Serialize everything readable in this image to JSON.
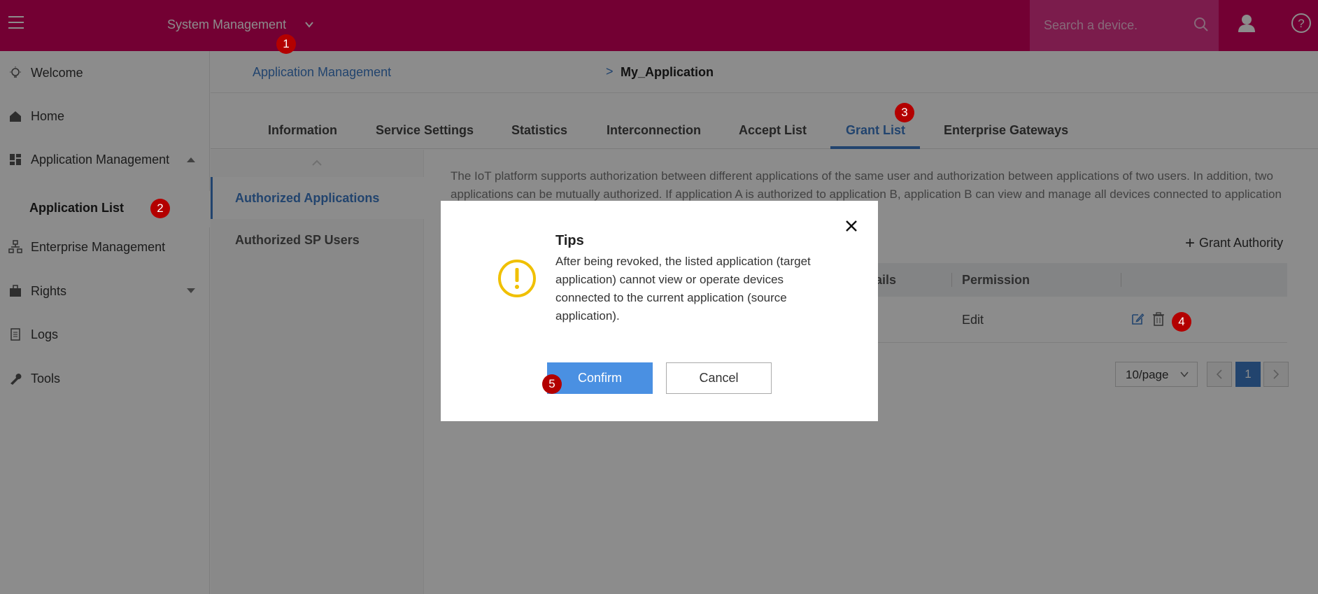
{
  "header": {
    "menu_icon": "hamburger-icon",
    "system_menu": "System Management",
    "search_placeholder": "Search a device.",
    "search_icon": "search-icon",
    "user_icon": "user-icon",
    "help_icon": "help-icon",
    "brand_color": "#d1005d"
  },
  "sidebar": {
    "items": [
      {
        "label": "Welcome",
        "icon": "lightbulb-icon"
      },
      {
        "label": "Home",
        "icon": "home-icon"
      },
      {
        "label": "Application Management",
        "icon": "dashboard-icon"
      },
      {
        "label": "Application List"
      },
      {
        "label": "Enterprise Management",
        "icon": "org-chart-icon"
      },
      {
        "label": "Rights",
        "icon": "briefcase-icon"
      },
      {
        "label": "Logs",
        "icon": "document-icon"
      },
      {
        "label": "Tools",
        "icon": "wrench-icon"
      }
    ]
  },
  "breadcrumb": {
    "parent": "Application Management",
    "separator": ">",
    "current": "My_Application"
  },
  "tabs": [
    {
      "label": "Information"
    },
    {
      "label": "Service Settings"
    },
    {
      "label": "Statistics"
    },
    {
      "label": "Interconnection"
    },
    {
      "label": "Accept List"
    },
    {
      "label": "Grant List",
      "active": true
    },
    {
      "label": "Enterprise Gateways"
    }
  ],
  "subnav": {
    "items": [
      {
        "label": "Authorized Applications",
        "active": true
      },
      {
        "label": "Authorized SP Users"
      }
    ]
  },
  "content": {
    "description": "The IoT platform supports authorization between different applications of the same user and authorization between applications of two users. In addition, two applications can be mutually authorized. If application A is authorized to application B, application B can view and manage all devices connected to application A and perform batch operations on devices connected to application A.",
    "grant_button": "Grant Authority",
    "table": {
      "headers": [
        "Details",
        "Permission"
      ],
      "rows": [
        {
          "permission": "Edit"
        }
      ]
    },
    "pagination": {
      "page_size": "10/page",
      "current_page": "1"
    }
  },
  "dialog": {
    "title": "Tips",
    "icon": "warning-icon",
    "message": "After being revoked, the listed application (target application) cannot view or operate devices connected to the current application (source application).",
    "confirm_label": "Confirm",
    "cancel_label": "Cancel",
    "confirm_color": "#4a90e2"
  },
  "markers": [
    "1",
    "2",
    "3",
    "4",
    "5"
  ]
}
